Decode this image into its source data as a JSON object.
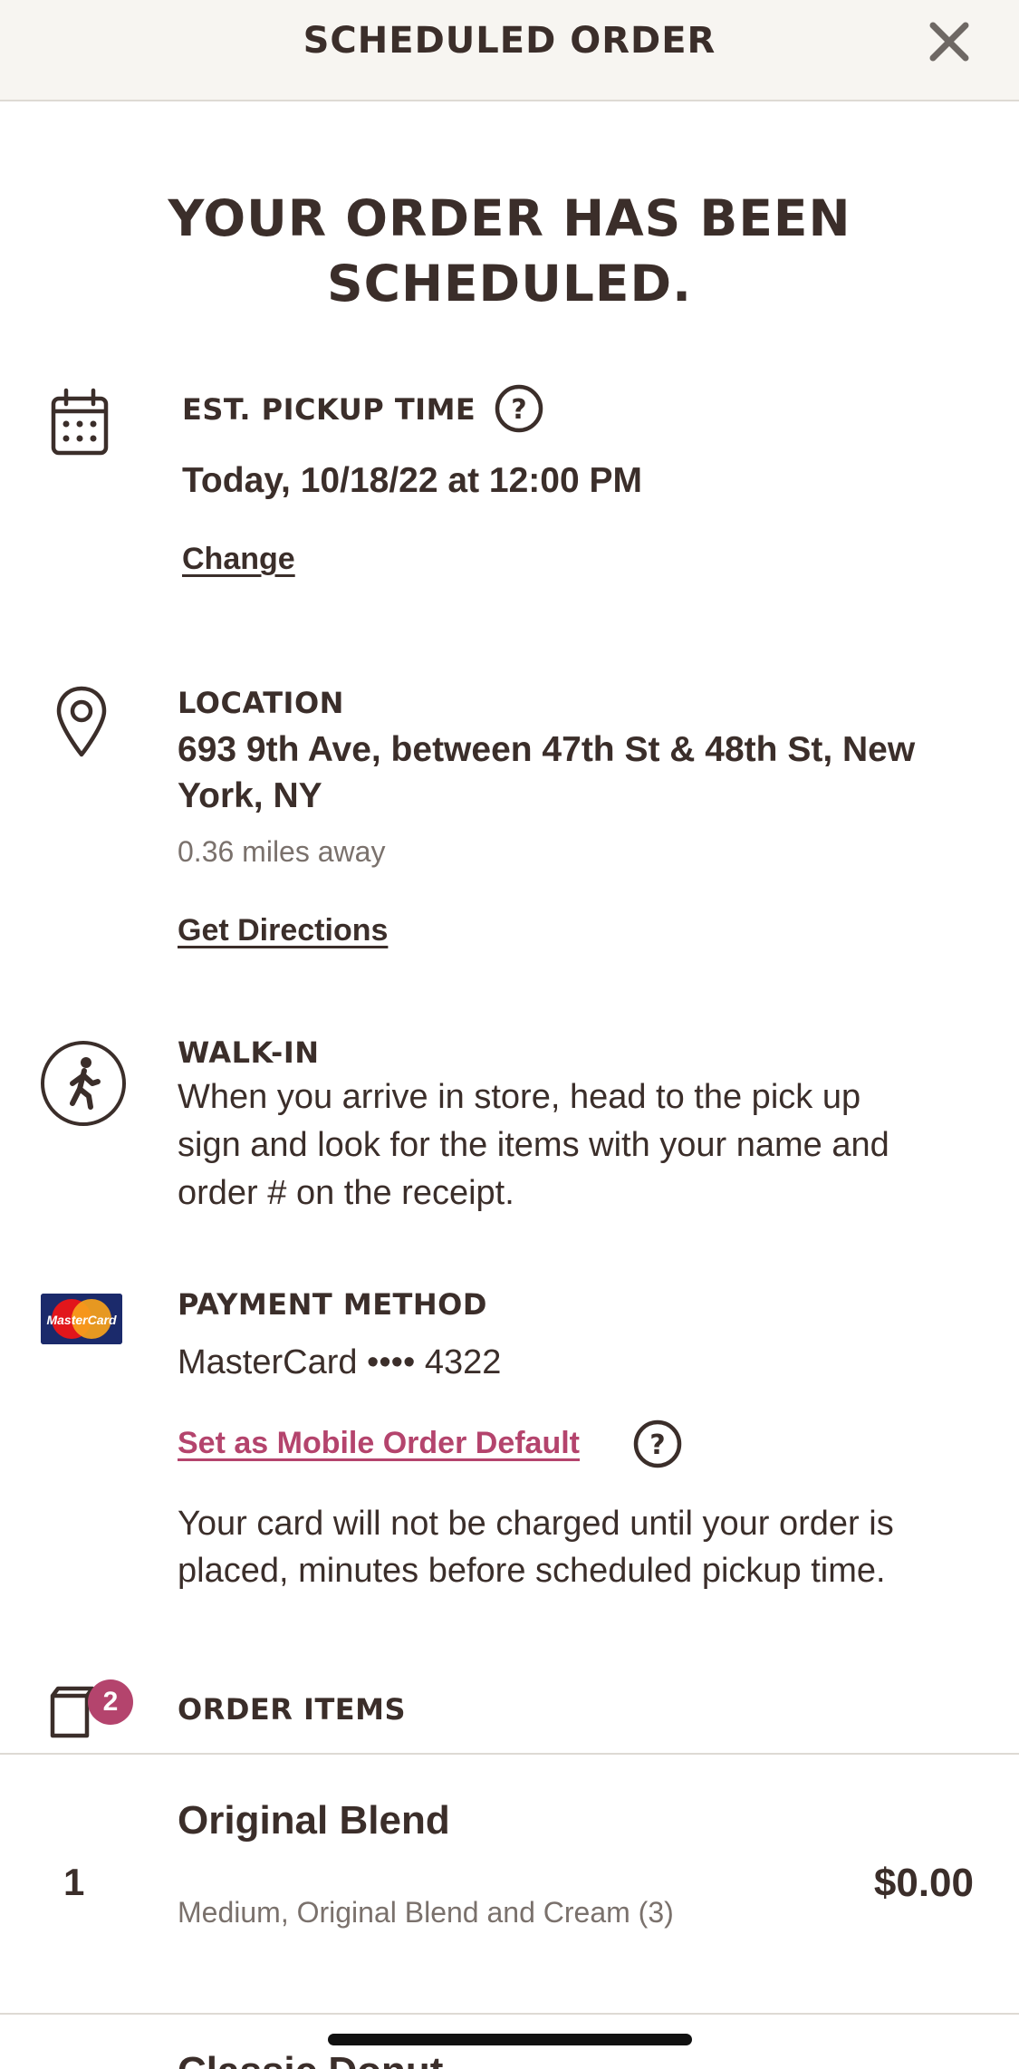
{
  "header": {
    "title": "SCHEDULED ORDER"
  },
  "headline": {
    "line1": "YOUR ORDER HAS BEEN",
    "line2": "SCHEDULED."
  },
  "pickup": {
    "label": "EST. PICKUP TIME",
    "value": "Today, 10/18/22 at 12:00 PM",
    "change_link": "Change"
  },
  "location": {
    "label": "LOCATION",
    "address_line1": "693 9th Ave, between 47th St & 48th St, New",
    "address_line2": "York,  NY",
    "distance": "0.36 miles away",
    "directions_link": "Get Directions"
  },
  "walkin": {
    "label": "WALK-IN",
    "line1": "When you arrive in store, head to the pick up",
    "line2": "sign and look for the items with your name and",
    "line3": "order # on the receipt."
  },
  "payment": {
    "label": "PAYMENT METHOD",
    "card": "MasterCard •••• 4322",
    "card_logo_text": "MasterCard",
    "default_link": "Set as Mobile Order Default",
    "note_line1": "Your card will not be charged until your order is",
    "note_line2": "placed, minutes before scheduled pickup time."
  },
  "order_items": {
    "label": "ORDER ITEMS",
    "count": "2",
    "items": [
      {
        "qty": "1",
        "name": "Original Blend",
        "description": "Medium, Original Blend and Cream (3)",
        "price": "$0.00"
      },
      {
        "name": "Classic Donut"
      }
    ]
  },
  "colors": {
    "text": "#3b2e2a",
    "accent": "#b4446d",
    "muted": "#7a716c",
    "header_bg": "#f7f5f1"
  }
}
